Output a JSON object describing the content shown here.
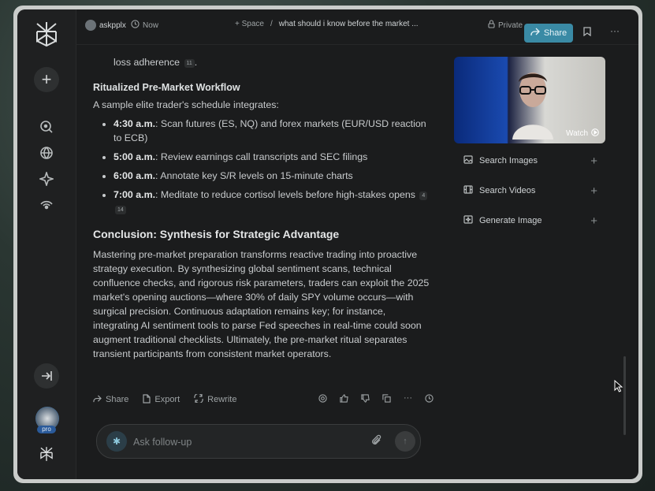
{
  "topbar": {
    "user": "askpplx",
    "time": "Now",
    "space": "+ Space",
    "separator": "/",
    "title": "what should i know before the market ...",
    "privacy": "Private",
    "share": "Share"
  },
  "content": {
    "partial_line": "loss adherence",
    "partial_cite": "11",
    "workflow_heading": "Ritualized Pre-Market Workflow",
    "workflow_intro": "A sample elite trader's schedule integrates:",
    "schedule": [
      {
        "time": "4:30 a.m.",
        "text": ": Scan futures (ES, NQ) and forex markets (EUR/USD reaction to ECB)"
      },
      {
        "time": "5:00 a.m.",
        "text": ": Review earnings call transcripts and SEC filings"
      },
      {
        "time": "6:00 a.m.",
        "text": ": Annotate key S/R levels on 15-minute charts"
      },
      {
        "time": "7:00 a.m.",
        "text": ": Meditate to reduce cortisol levels before high-stakes opens"
      }
    ],
    "schedule_cites": [
      "4",
      "14"
    ],
    "conclusion_heading": "Conclusion: Synthesis for Strategic Advantage",
    "conclusion_text": "Mastering pre-market preparation transforms reactive trading into proactive strategy execution. By synthesizing global sentiment scans, technical confluence checks, and rigorous risk parameters, traders can exploit the 2025 market's opening auctions—where 30% of daily SPY volume occurs—with surgical precision. Continuous adaptation remains key; for instance, integrating AI sentiment tools to parse Fed speeches in real-time could soon augment traditional checklists. Ultimately, the pre-market ritual separates transient participants from consistent market operators."
  },
  "actions": {
    "share": "Share",
    "export": "Export",
    "rewrite": "Rewrite"
  },
  "ask": {
    "placeholder": "Ask follow-up"
  },
  "sidebar": {
    "pro_badge": "pro"
  },
  "right_panel": {
    "watch": "Watch",
    "items": [
      {
        "label": "Search Images",
        "icon": "image-icon"
      },
      {
        "label": "Search Videos",
        "icon": "film-icon"
      },
      {
        "label": "Generate Image",
        "icon": "sparkle-image-icon"
      }
    ]
  },
  "colors": {
    "accent": "#3a8aa5",
    "background": "#1b1c1d"
  }
}
